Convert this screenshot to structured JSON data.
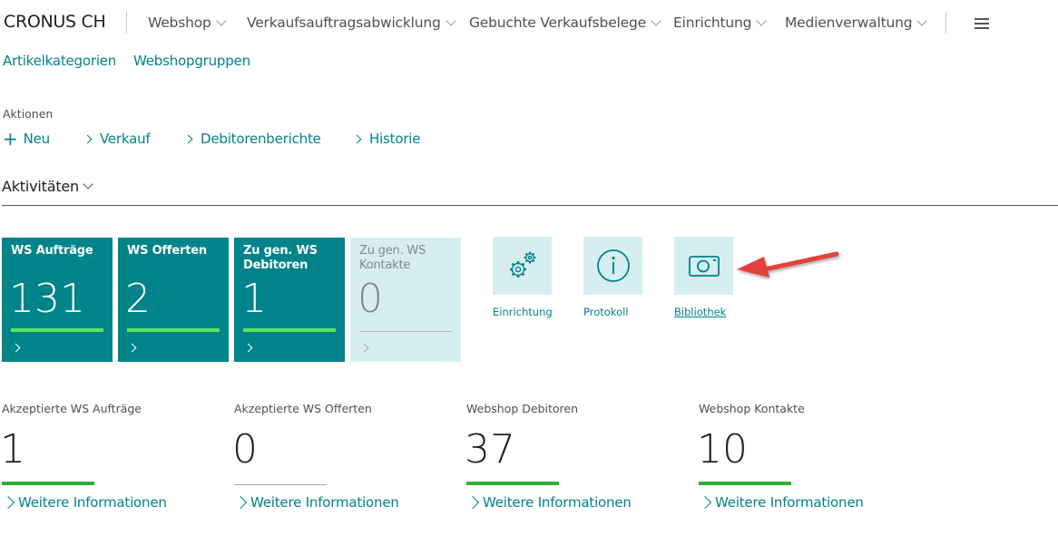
{
  "header": {
    "company": "CRONUS CH",
    "nav": [
      "Webshop",
      "Verkaufsauftragsabwicklung",
      "Gebuchte Verkaufsbelege",
      "Einrichtung",
      "Medienverwaltung"
    ]
  },
  "subnav": [
    "Artikelkategorien",
    "Webshopgruppen"
  ],
  "actions": {
    "label": "Aktionen",
    "new_label": "Neu",
    "items": [
      "Verkauf",
      "Debitorenberichte",
      "Historie"
    ]
  },
  "activities": {
    "title": "Aktivitäten",
    "tiles": [
      {
        "title": "WS Aufträge",
        "value": "131",
        "active": true
      },
      {
        "title": "WS Offerten",
        "value": "2",
        "active": true
      },
      {
        "title": "Zu gen. WS Debitoren",
        "value": "1",
        "active": true
      },
      {
        "title": "Zu gen. WS Kontakte",
        "value": "0",
        "active": false
      }
    ],
    "action_tiles": [
      {
        "label": "Einrichtung",
        "icon": "gears-icon"
      },
      {
        "label": "Protokoll",
        "icon": "info-icon"
      },
      {
        "label": "Bibliothek",
        "icon": "camera-icon"
      }
    ]
  },
  "kpis": [
    {
      "label": "Akzeptierte WS Aufträge",
      "value": "1",
      "link": "Weitere Informationen"
    },
    {
      "label": "Akzeptierte WS Offerten",
      "value": "0",
      "link": "Weitere Informationen"
    },
    {
      "label": "Webshop Debitoren",
      "value": "37",
      "link": "Weitere Informationen"
    },
    {
      "label": "Webshop Kontakte",
      "value": "10",
      "link": "Weitere Informationen"
    }
  ],
  "colors": {
    "accent": "#00838a",
    "tile_active": "#008389",
    "tile_inactive": "#d7eef0",
    "tile_bar": "#5ce65c",
    "kpi_bar": "#2fae3a",
    "annotation_arrow": "#e2433b"
  }
}
